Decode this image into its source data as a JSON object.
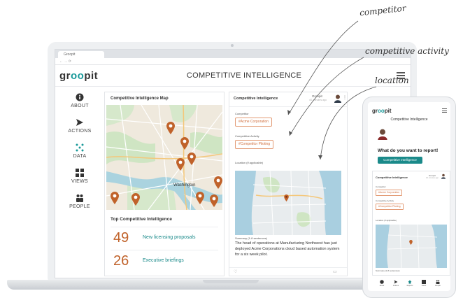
{
  "browser": {
    "tab_title": "Groopit",
    "url": "← → ⟳"
  },
  "app": {
    "logo_prefix": "gr",
    "logo_oo": "oo",
    "logo_suffix": "pit",
    "page_title": "COMPETITIVE INTELLIGENCE"
  },
  "nav": {
    "items": [
      {
        "label": "ABOUT",
        "icon": "info-icon"
      },
      {
        "label": "ACTIONS",
        "icon": "send-icon"
      },
      {
        "label": "DATA",
        "icon": "data-icon"
      },
      {
        "label": "VIEWS",
        "icon": "views-icon"
      },
      {
        "label": "PEOPLE",
        "icon": "people-icon"
      }
    ]
  },
  "map_card": {
    "title": "Competitive Intelligence Map",
    "city_label": "Washington",
    "top_title": "Top Competitive Intelligence",
    "stats": [
      {
        "value": "49",
        "label": "New licensing  proposals"
      },
      {
        "value": "26",
        "label": "Executive briefings"
      }
    ]
  },
  "form_card": {
    "title": "Competitive Intelligence",
    "user": "Groopit",
    "date": "4/1 minutes ago",
    "competitor_label": "Competitor",
    "competitor_value": "#Acme Corporation",
    "activity_label": "Competitive Activity",
    "activity_value": "#Competitor Piloting",
    "location_label": "Location (if applicable)",
    "summary_label": "Summary (1-8 sentences)",
    "summary_text": "The head of operations at Manufacturing Northwest has just deployed Acme Corporations cloud based automation system for a six week pilot."
  },
  "annotations": {
    "competitor": "competitor",
    "activity": "competitive activity",
    "location": "location"
  },
  "phone": {
    "logo_prefix": "gr",
    "logo_oo": "oo",
    "logo_suffix": "pit",
    "title": "Competitive Intelligence",
    "question": "What do you want to report!",
    "button": "Competitive Intelligence",
    "card_title": "Competitive Intelligence",
    "card_user": "Groopit",
    "card_date": "4/1 minutes ago",
    "competitor_label": "Competitor",
    "competitor_value": "#Acme Corporation",
    "activity_label": "Competitive Activity",
    "activity_value": "#Competitor Piloting",
    "location_label": "Location (if applicable)",
    "summary_label": "Summary (1-8 sentences)",
    "nav": [
      "About",
      "Actions",
      "Reports",
      "Views",
      "People"
    ]
  },
  "colors": {
    "accent": "#1a8a8a",
    "pin": "#c0622a",
    "tag_border": "#e39b75"
  }
}
